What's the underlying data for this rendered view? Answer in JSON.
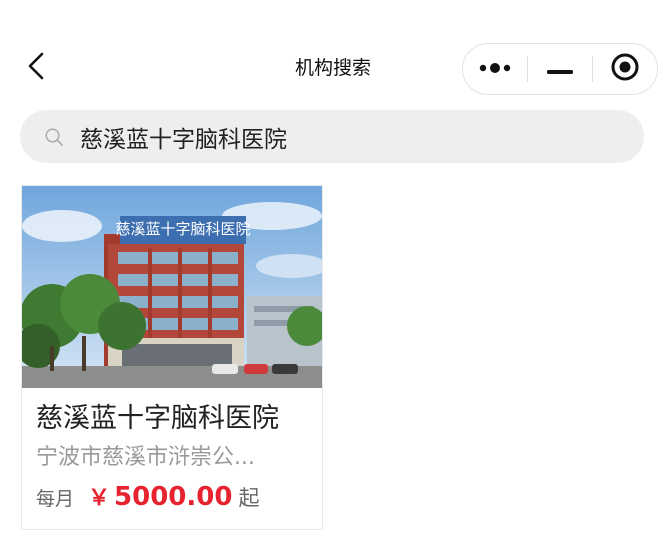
{
  "navbar": {
    "title": "机构搜索",
    "back_icon": "chevron-left-icon",
    "capsule": {
      "more_icon": "more-dots-icon",
      "minimize_icon": "minimize-icon",
      "close_icon": "target-close-icon"
    }
  },
  "search": {
    "icon": "search-icon",
    "value": "慈溪蓝十字脑科医院"
  },
  "results": [
    {
      "name": "慈溪蓝十字脑科医院",
      "address": "宁波市慈溪市浒崇公...",
      "price_prefix": "每月",
      "price_currency": "￥",
      "price_value": "5000.00",
      "price_suffix": "起",
      "image_sign_text": "慈溪蓝十字脑科医院"
    }
  ],
  "colors": {
    "price": "#e6232f",
    "search_bg": "#eeeeee",
    "secondary_text": "#9a9a9a"
  }
}
